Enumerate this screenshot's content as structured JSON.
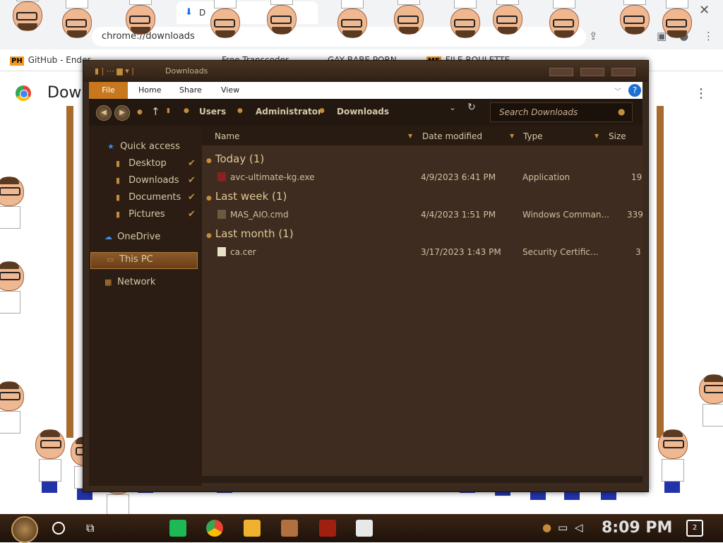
{
  "chrome": {
    "tab_title": "D",
    "omnibox_text": "chrome://downloads",
    "bookmarks": [
      {
        "badge": "PH",
        "label": "GitHub - Ender"
      },
      {
        "badge": "",
        "label": "Free Transcoder"
      },
      {
        "badge": "",
        "label": "GAY BABE PORN"
      },
      {
        "badge": "MF",
        "label": "FILE ROULETTE"
      }
    ],
    "page_title": "Downloads",
    "close_glyph": "✕",
    "menu_glyph": "⋮"
  },
  "explorer": {
    "title": "Downloads",
    "ribbon_tabs": [
      "File",
      "Home",
      "Share",
      "View"
    ],
    "help_label": "?",
    "breadcrumb": [
      "Users",
      "Administrator",
      "Downloads"
    ],
    "search_placeholder": "Search Downloads",
    "nav": {
      "quick_access": "Quick access",
      "desktop": "Desktop",
      "downloads": "Downloads",
      "documents": "Documents",
      "pictures": "Pictures",
      "onedrive": "OneDrive",
      "this_pc": "This PC",
      "network": "Network"
    },
    "columns": {
      "name": "Name",
      "date": "Date modified",
      "type": "Type",
      "size": "Size"
    },
    "groups": [
      {
        "label": "Today (1)",
        "files": [
          {
            "name": "avc-ultimate-kg.exe",
            "date": "4/9/2023 6:41 PM",
            "type": "Application",
            "size": "19"
          }
        ]
      },
      {
        "label": "Last week (1)",
        "files": [
          {
            "name": "MAS_AIO.cmd",
            "date": "4/4/2023 1:51 PM",
            "type": "Windows Comman...",
            "size": "339"
          }
        ]
      },
      {
        "label": "Last month (1)",
        "files": [
          {
            "name": "ca.cer",
            "date": "3/17/2023 1:43 PM",
            "type": "Security Certific...",
            "size": "3"
          }
        ]
      }
    ]
  },
  "taskbar": {
    "clock": "8:09 PM",
    "notification_count": "2"
  },
  "colors": {
    "accent": "#c8781c",
    "window_bg": "#3a2a1e",
    "text": "#d8c8a8"
  }
}
